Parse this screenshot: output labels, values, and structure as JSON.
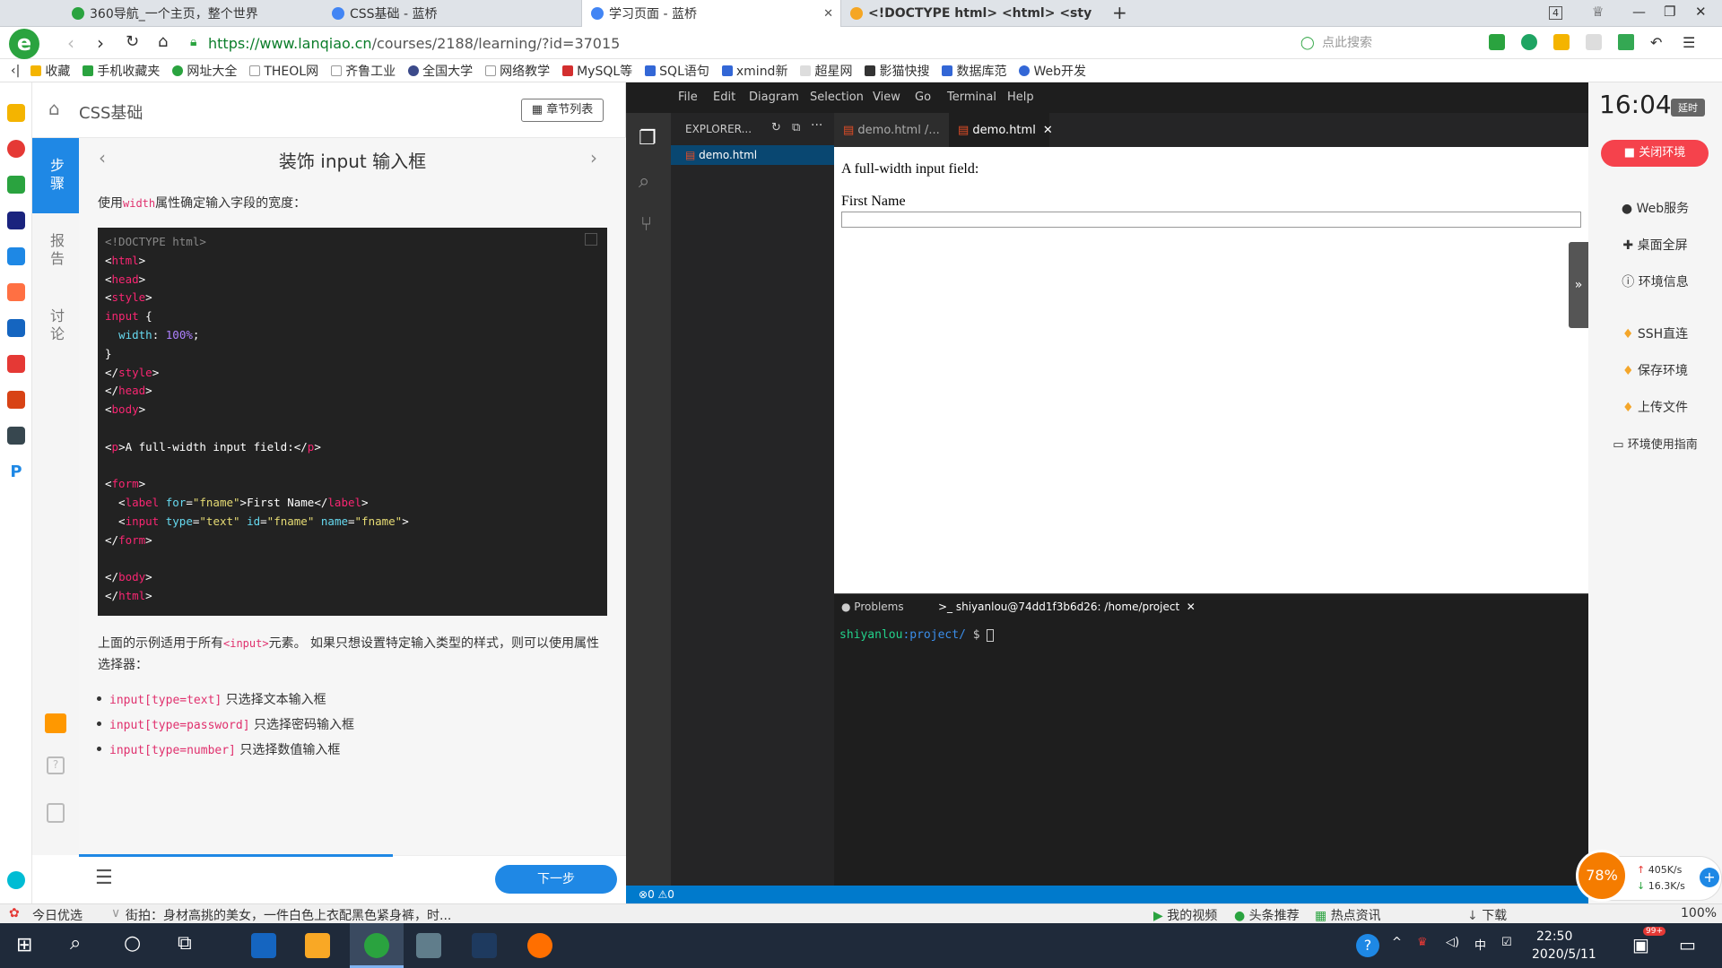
{
  "tabs": [
    {
      "title": "360导航_一个主页，整个世界",
      "color": "#2aa33f"
    },
    {
      "title": "CSS基础 - 蓝桥",
      "color": "#4285f4"
    },
    {
      "title": "学习页面 - 蓝桥",
      "color": "#4285f4"
    },
    {
      "title": "<!DOCTYPE html> <html> <sty",
      "color": "#f5a623"
    }
  ],
  "tab_count": "4",
  "url": {
    "scheme_host": "https://www.lanqiao.cn",
    "path": "/courses/2188/learning/?id=37015"
  },
  "search_placeholder": "点此搜索",
  "bookmarks": [
    "收藏",
    "手机收藏夹",
    "网址大全",
    "THEOL网",
    "齐鲁工业",
    "全国大学",
    "网络教学",
    "MySQL等",
    "SQL语句",
    "xmind新",
    "超星网",
    "影猫快搜",
    "数据库范",
    "Web开发"
  ],
  "lanqiao": {
    "course": "CSS基础",
    "chapter_btn": "章节列表",
    "side": {
      "steps": "步骤",
      "report": "报告",
      "discuss": "讨论"
    },
    "title": "装饰 input 输入框",
    "intro_pre": "使用",
    "intro_code": "width",
    "intro_post": "属性确定输入字段的宽度：",
    "para_pre": "上面的示例适用于所有",
    "para_code": "<input>",
    "para_post": "元素。 如果只想设置特定输入类型的样式，则可以使用属性选择器：",
    "list": [
      {
        "code": "input[type=text]",
        "text": " 只选择文本输入框"
      },
      {
        "code": "input[type=password]",
        "text": " 只选择密码输入框"
      },
      {
        "code": "input[type=number]",
        "text": " 只选择数值输入框"
      }
    ],
    "next_btn": "下一步"
  },
  "vscode": {
    "menu": [
      "File",
      "Edit",
      "Diagram",
      "Selection",
      "View",
      "Go",
      "Terminal",
      "Help"
    ],
    "explorer_title": "EXPLORER...",
    "explorer_file": "demo.html",
    "tab1": "demo.html /...",
    "tab2": "demo.html",
    "preview_p": "A full-width input field:",
    "preview_label": "First Name",
    "term_tab_problems": "Problems",
    "term_tab_shell": ">_ shiyanlou@74dd1f3b6d26: /home/project",
    "prompt_user": "shiyanlou",
    "prompt_path": ":project/",
    "prompt_sign": " $ ",
    "status_errors": "0",
    "status_warnings": "0"
  },
  "right_panel": {
    "time": "16:04",
    "delay": "延时",
    "close_env": "关闭环境",
    "items": [
      "Web服务",
      "桌面全屏",
      "环境信息",
      "SSH直连",
      "保存环境",
      "上传文件",
      "环境使用指南"
    ]
  },
  "net_widget": {
    "percent": "78%",
    "up": "405K/s",
    "down": "16.3K/s"
  },
  "statusbar": {
    "left": "今日优选",
    "news": "街拍：身材高挑的美女，一件白色上衣配黑色紧身裤，时...",
    "right": [
      "我的视频",
      "头条推荐",
      "热点资讯",
      "下载"
    ],
    "zoom": "100%"
  },
  "taskbar": {
    "time": "22:50",
    "date": "2020/5/11",
    "ime": "中",
    "badge": "99+"
  },
  "colors": {
    "accent": "#1f88e5",
    "vscode_blue": "#007acc",
    "close_red": "#f5424c"
  }
}
